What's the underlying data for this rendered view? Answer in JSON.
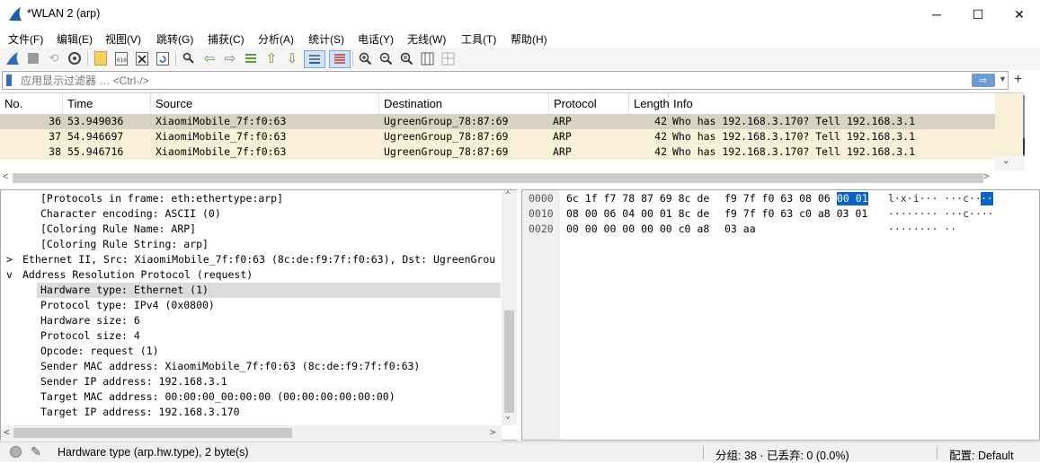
{
  "window": {
    "title": "*WLAN 2 (arp)",
    "minimize": "─",
    "maximize": "☐",
    "close": "✕"
  },
  "menu": [
    "文件(F)",
    "编辑(E)",
    "视图(V)",
    "跳转(G)",
    "捕获(C)",
    "分析(A)",
    "统计(S)",
    "电话(Y)",
    "无线(W)",
    "工具(T)",
    "帮助(H)"
  ],
  "filter": {
    "placeholder": "应用显示过滤器 … <Ctrl-/>",
    "apply_arrow": "⇨",
    "dropdown": "▼",
    "add": "+"
  },
  "packet_list": {
    "columns": [
      "No.",
      "Time",
      "Source",
      "Destination",
      "Protocol",
      "Length",
      "Info"
    ],
    "rows": [
      {
        "no": "36",
        "time": "53.949036",
        "source": "XiaomiMobile_7f:f0:63",
        "destination": "UgreenGroup_78:87:69",
        "protocol": "ARP",
        "length": "42",
        "info": "Who has 192.168.3.170? Tell 192.168.3.1"
      },
      {
        "no": "37",
        "time": "54.946697",
        "source": "XiaomiMobile_7f:f0:63",
        "destination": "UgreenGroup_78:87:69",
        "protocol": "ARP",
        "length": "42",
        "info": "Who has 192.168.3.170? Tell 192.168.3.1"
      },
      {
        "no": "38",
        "time": "55.946716",
        "source": "XiaomiMobile_7f:f0:63",
        "destination": "UgreenGroup_78:87:69",
        "protocol": "ARP",
        "length": "42",
        "info": "Who has 192.168.3.170? Tell 192.168.3.1"
      }
    ],
    "selected_row": 0
  },
  "details": {
    "lines": [
      {
        "text": "[Protocols in frame: eth:ethertype:arp]",
        "level": 1,
        "expander": ""
      },
      {
        "text": "Character encoding: ASCII (0)",
        "level": 1,
        "expander": ""
      },
      {
        "text": "[Coloring Rule Name: ARP]",
        "level": 1,
        "expander": ""
      },
      {
        "text": "[Coloring Rule String: arp]",
        "level": 1,
        "expander": ""
      },
      {
        "text": "Ethernet II, Src: XiaomiMobile_7f:f0:63 (8c:de:f9:7f:f0:63), Dst: UgreenGrou",
        "level": 0,
        "expander": ">"
      },
      {
        "text": "Address Resolution Protocol (request)",
        "level": 0,
        "expander": "v"
      },
      {
        "text": "Hardware type: Ethernet (1)",
        "level": 1,
        "expander": "",
        "selected": true
      },
      {
        "text": "Protocol type: IPv4 (0x0800)",
        "level": 1,
        "expander": ""
      },
      {
        "text": "Hardware size: 6",
        "level": 1,
        "expander": ""
      },
      {
        "text": "Protocol size: 4",
        "level": 1,
        "expander": ""
      },
      {
        "text": "Opcode: request (1)",
        "level": 1,
        "expander": ""
      },
      {
        "text": "Sender MAC address: XiaomiMobile_7f:f0:63 (8c:de:f9:7f:f0:63)",
        "level": 1,
        "expander": ""
      },
      {
        "text": "Sender IP address: 192.168.3.1",
        "level": 1,
        "expander": ""
      },
      {
        "text": "Target MAC address: 00:00:00_00:00:00 (00:00:00:00:00:00)",
        "level": 1,
        "expander": ""
      },
      {
        "text": "Target IP address: 192.168.3.170",
        "level": 1,
        "expander": ""
      }
    ]
  },
  "bytes": {
    "rows": [
      {
        "offset": "0000",
        "hex_a": "6c 1f f7 78 87 69 8c de",
        "hex_b": "f9 7f f0 63 08 06",
        "hex_sel": "00 01",
        "ascii": "l·x·i··· ···c··",
        "ascii_sel": "··"
      },
      {
        "offset": "0010",
        "hex_a": "08 00 06 04 00 01 8c de",
        "hex_b": "f9 7f f0 63 c0 a8 03 01",
        "hex_sel": "",
        "ascii": "········ ···c····",
        "ascii_sel": ""
      },
      {
        "offset": "0020",
        "hex_a": "00 00 00 00 00 00 c0 a8",
        "hex_b": "03 aa",
        "hex_sel": "",
        "ascii": "········ ··",
        "ascii_sel": ""
      }
    ]
  },
  "status": {
    "field_info": "Hardware type (arp.hw.type), 2 byte(s)",
    "packets": "分组: 38 · 已丢弃: 0 (0.0%)",
    "profile": "配置: Default"
  },
  "colors": {
    "selected_row": "#d8d2c4",
    "arp_row": "#faf0d7",
    "selected_detail": "#dcdcdc",
    "byte_highlight": "#0a64c8"
  }
}
